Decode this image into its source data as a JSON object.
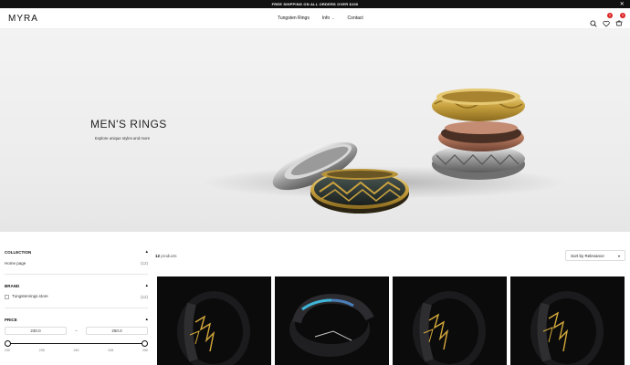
{
  "announcement": {
    "text": "FREE SHIPPING ON ALL ORDERS OVER $100",
    "close_icon": "close-icon"
  },
  "header": {
    "logo": "MYRA",
    "nav": [
      {
        "label": "Tungsten Rings"
      },
      {
        "label": "Info"
      },
      {
        "label": "Contact"
      }
    ],
    "icons": [
      "search-icon",
      "wishlist-icon",
      "cart-icon"
    ],
    "wishlist_count": "0",
    "cart_count": "0"
  },
  "hero": {
    "title": "MEN'S RINGS",
    "subtitle": "Explore unique styles and more"
  },
  "filters": {
    "collection": {
      "title": "COLLECTION",
      "items": [
        {
          "label": "Home page",
          "count": "(12)"
        }
      ]
    },
    "brand": {
      "title": "BRAND",
      "items": [
        {
          "label": "Tungstenrings.store",
          "count": "(12)"
        }
      ]
    },
    "price": {
      "title": "PRICE",
      "min": "230.0",
      "max": "250.0",
      "separator": "–",
      "ticks": [
        "230",
        "235",
        "240",
        "245",
        "250"
      ]
    }
  },
  "toolbar": {
    "product_count_number": "12",
    "product_count_label": "products",
    "sort_label": "Sort by Relevance"
  },
  "colors": {
    "accent": "#111111",
    "badge": "#dd2222",
    "hero_bg": "#ececec",
    "product_bg": "#0b0b0c"
  }
}
